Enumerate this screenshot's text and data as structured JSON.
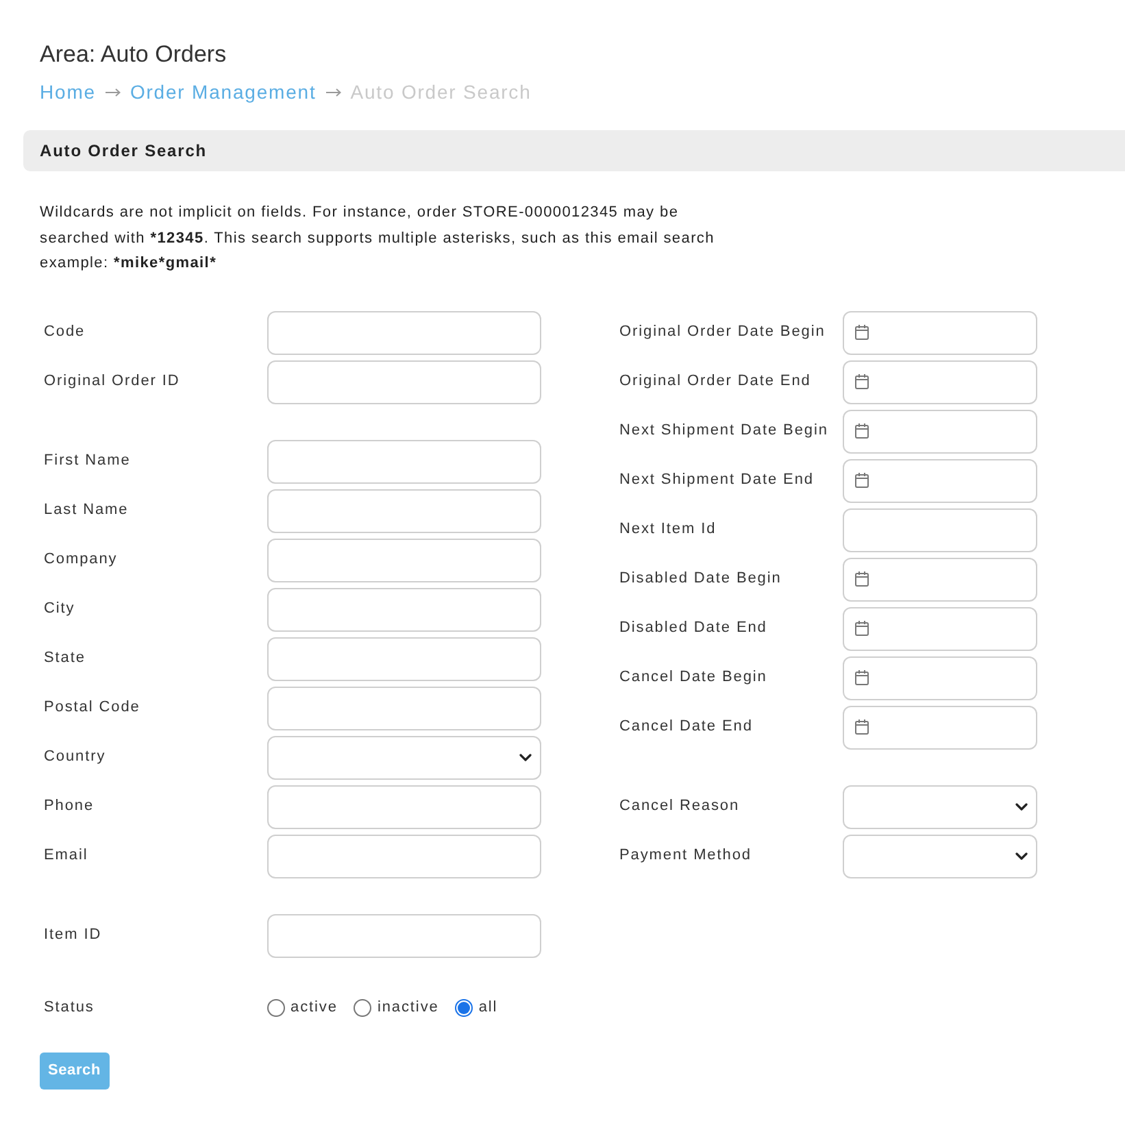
{
  "page": {
    "title": "Area: Auto Orders"
  },
  "breadcrumb": [
    {
      "label": "Home",
      "current": false
    },
    {
      "label": "Order Management",
      "current": false
    },
    {
      "label": "Auto Order Search",
      "current": true
    }
  ],
  "panel": {
    "title": "Auto Order Search"
  },
  "notice": [
    {
      "text": "Wildcards are not implicit on fields. For instance, order STORE-0000012345 may be searched with ",
      "bold": false
    },
    {
      "text": "*12345",
      "bold": true
    },
    {
      "text": ". This search supports multiple asterisks, such as this email search example: ",
      "bold": false
    },
    {
      "text": "*mike*gmail*",
      "bold": true
    }
  ],
  "left_column": [
    {
      "fields": [
        {
          "label": "Code",
          "kind": "text"
        },
        {
          "label": "Original Order ID",
          "kind": "text"
        }
      ]
    },
    {
      "fields": [
        {
          "label": "First Name",
          "kind": "text"
        },
        {
          "label": "Last Name",
          "kind": "text"
        },
        {
          "label": "Company",
          "kind": "text"
        },
        {
          "label": "City",
          "kind": "text"
        },
        {
          "label": "State",
          "kind": "text"
        },
        {
          "label": "Postal Code",
          "kind": "text"
        },
        {
          "label": "Country",
          "kind": "select"
        },
        {
          "label": "Phone",
          "kind": "text"
        },
        {
          "label": "Email",
          "kind": "text"
        }
      ]
    },
    {
      "fields": [
        {
          "label": "Item ID",
          "kind": "text"
        }
      ]
    }
  ],
  "right_column": [
    {
      "fields": [
        {
          "label": "Original Order Date Begin",
          "kind": "date"
        },
        {
          "label": "Original Order Date End",
          "kind": "date"
        },
        {
          "label": "Next Shipment Date Begin",
          "kind": "date"
        },
        {
          "label": "Next Shipment Date End",
          "kind": "date"
        },
        {
          "label": "Next Item Id",
          "kind": "text"
        },
        {
          "label": "Disabled Date Begin",
          "kind": "date"
        },
        {
          "label": "Disabled Date End",
          "kind": "date"
        },
        {
          "label": "Cancel Date Begin",
          "kind": "date"
        },
        {
          "label": "Cancel Date End",
          "kind": "date"
        }
      ]
    },
    {
      "fields": [
        {
          "label": "Cancel Reason",
          "kind": "select"
        },
        {
          "label": "Payment Method",
          "kind": "select"
        }
      ]
    }
  ],
  "status": {
    "label": "Status",
    "options": [
      {
        "label": "active",
        "selected": false
      },
      {
        "label": "inactive",
        "selected": false
      },
      {
        "label": "all",
        "selected": true
      }
    ]
  },
  "search_button": {
    "label": "Search"
  }
}
